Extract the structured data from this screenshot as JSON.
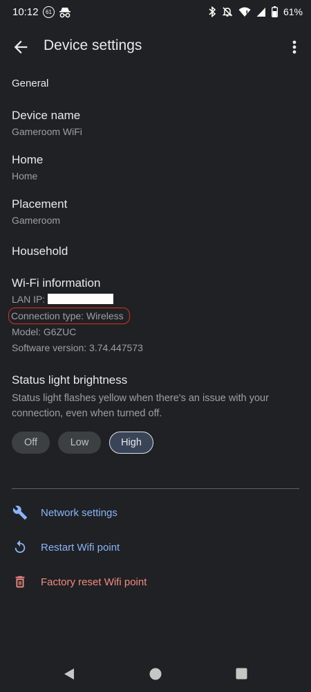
{
  "status_bar": {
    "time": "10:12",
    "notification_count": "61",
    "battery": "61%",
    "icons": [
      "notification-badge-icon",
      "incognito-icon",
      "bluetooth-icon",
      "mute-icon",
      "wifi-icon",
      "signal-icon",
      "battery-icon"
    ]
  },
  "app_bar": {
    "title": "Device settings",
    "back_icon": "arrow-back-icon",
    "menu_icon": "more-vert-icon"
  },
  "general": {
    "header": "General",
    "items": [
      {
        "title": "Device name",
        "subtitle": "Gameroom WiFi"
      },
      {
        "title": "Home",
        "subtitle": "Home"
      },
      {
        "title": "Placement",
        "subtitle": "Gameroom"
      },
      {
        "title": "Household",
        "subtitle": ""
      }
    ]
  },
  "wifi_info": {
    "title": "Wi-Fi information",
    "lan_ip_label": "LAN IP:",
    "connection_type": "Connection type: Wireless",
    "model": "Model: G6ZUC",
    "software_version": "Software version: 3.74.447573",
    "highlight_color": "#d93025"
  },
  "status_light": {
    "title": "Status light brightness",
    "description": "Status light flashes yellow when there's an issue with your connection, even when turned off.",
    "options": [
      "Off",
      "Low",
      "High"
    ],
    "selected": "High"
  },
  "actions": [
    {
      "label": "Network settings",
      "icon": "wrench-icon",
      "color": "#8ab4f8"
    },
    {
      "label": "Restart Wifi point",
      "icon": "restart-icon",
      "color": "#8ab4f8"
    },
    {
      "label": "Factory reset Wifi point",
      "icon": "trash-icon",
      "color": "#f28b82"
    }
  ],
  "nav_bar": {
    "buttons": [
      "back-triangle-icon",
      "home-circle-icon",
      "recents-square-icon"
    ]
  }
}
